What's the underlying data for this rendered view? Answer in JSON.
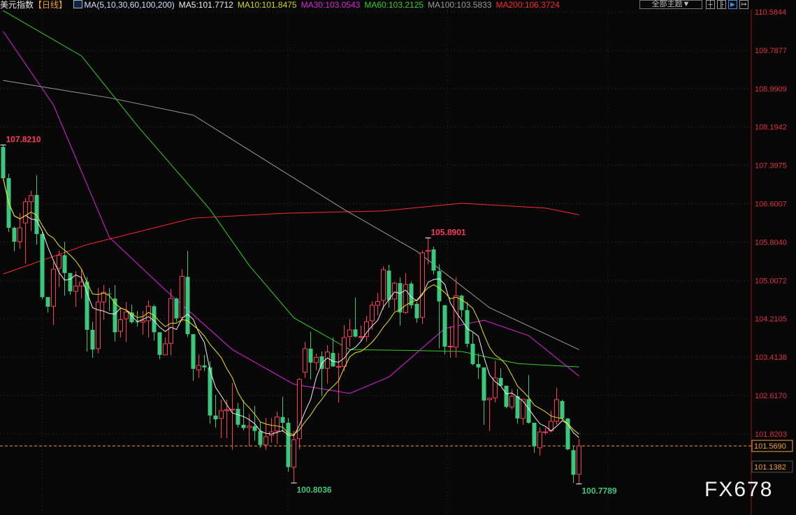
{
  "header": {
    "title": "美元指数",
    "period": "【日线】",
    "ma_params": "MA(5,10,30,60,100,200)",
    "ma5": "MA5:101.7712",
    "ma10": "MA10:101.8475",
    "ma30": "MA30:103.0543",
    "ma60": "MA60:103.2125",
    "ma100": "MA100:103.5833",
    "ma200": "MA200:106.3724"
  },
  "toolbar": {
    "theme_label": "全部主题▼",
    "icons": [
      "crosshair-icon",
      "bar-range-icon",
      "play-icon",
      "export-icon"
    ]
  },
  "watermark": "FX678",
  "colors": {
    "up": "#ff3a55",
    "down": "#3cc87c",
    "ma5": "#f0f0f0",
    "ma10": "#e8e800",
    "ma30": "#e020e0",
    "ma60": "#30d020",
    "ma100": "#9a9a9a",
    "ma200": "#ff2a2a"
  },
  "chart_data": {
    "type": "candlestick",
    "title": "美元指数 日线",
    "y_ticks": [
      "110.5844",
      "109.7877",
      "108.9909",
      "108.1942",
      "107.3975",
      "106.6007",
      "105.8040",
      "105.0072",
      "104.2105",
      "103.4138",
      "102.6170",
      "101.8203"
    ],
    "ylim": [
      100.6,
      110.83
    ],
    "current_price": "101.5690",
    "cursor_price": "101.1382",
    "annotations": [
      {
        "index": 0,
        "text": "107.8210",
        "type": "high"
      },
      {
        "index": 76,
        "text": "105.8901",
        "type": "high"
      },
      {
        "index": 52,
        "text": "100.8036",
        "type": "low"
      },
      {
        "index": 103,
        "text": "100.7789",
        "type": "low"
      }
    ],
    "ohlc": [
      [
        107.78,
        107.82,
        107.1,
        107.13
      ],
      [
        107.13,
        107.22,
        106.01,
        106.1
      ],
      [
        106.1,
        106.13,
        105.61,
        105.81
      ],
      [
        105.81,
        106.4,
        105.66,
        106.1
      ],
      [
        106.2,
        106.72,
        105.36,
        106.64
      ],
      [
        106.64,
        106.87,
        106.03,
        106.77
      ],
      [
        106.78,
        107.19,
        105.75,
        105.97
      ],
      [
        105.97,
        106.01,
        104.62,
        104.66
      ],
      [
        104.66,
        104.66,
        104.34,
        104.46
      ],
      [
        104.47,
        105.39,
        104.08,
        105.24
      ],
      [
        105.26,
        105.63,
        104.87,
        105.53
      ],
      [
        105.53,
        105.81,
        104.69,
        105.16
      ],
      [
        105.16,
        105.16,
        104.71,
        104.78
      ],
      [
        104.78,
        105.2,
        104.46,
        104.89
      ],
      [
        104.89,
        105.24,
        104.63,
        104.97
      ],
      [
        104.98,
        105.08,
        103.53,
        103.98
      ],
      [
        103.98,
        104.15,
        103.4,
        103.57
      ],
      [
        103.59,
        104.85,
        103.49,
        104.56
      ],
      [
        104.56,
        104.91,
        104.19,
        104.76
      ],
      [
        104.73,
        104.85,
        104.37,
        104.72
      ],
      [
        104.63,
        104.91,
        103.74,
        103.93
      ],
      [
        103.95,
        104.41,
        103.82,
        104.19
      ],
      [
        104.21,
        104.56,
        103.73,
        104.35
      ],
      [
        104.34,
        104.5,
        104.11,
        104.14
      ],
      [
        104.15,
        104.37,
        104.05,
        104.14
      ],
      [
        104.14,
        104.37,
        103.88,
        104.17
      ],
      [
        104.17,
        104.59,
        103.82,
        104.47
      ],
      [
        104.47,
        104.5,
        103.76,
        103.93
      ],
      [
        103.93,
        103.93,
        103.37,
        103.46
      ],
      [
        103.46,
        103.82,
        103.45,
        103.69
      ],
      [
        103.7,
        104.83,
        103.45,
        104.63
      ],
      [
        104.63,
        104.65,
        104.15,
        104.22
      ],
      [
        104.24,
        105.24,
        104.15,
        105.09
      ],
      [
        105.08,
        105.62,
        103.83,
        103.89
      ],
      [
        103.89,
        103.89,
        102.92,
        103.17
      ],
      [
        103.15,
        103.47,
        102.98,
        103.24
      ],
      [
        103.24,
        103.46,
        103.12,
        103.2
      ],
      [
        103.2,
        103.33,
        102.03,
        102.2
      ],
      [
        102.2,
        102.63,
        101.95,
        102.12
      ],
      [
        102.14,
        102.53,
        101.73,
        102.3
      ],
      [
        102.3,
        102.53,
        101.73,
        102.32
      ],
      [
        102.32,
        102.88,
        101.49,
        102.33
      ],
      [
        102.34,
        102.46,
        101.95,
        102.01
      ],
      [
        102.01,
        102.52,
        101.89,
        101.94
      ],
      [
        101.95,
        102.24,
        101.56,
        101.98
      ],
      [
        101.98,
        102.4,
        101.68,
        101.88
      ],
      [
        101.88,
        102.08,
        101.53,
        101.59
      ],
      [
        101.59,
        102.15,
        101.49,
        101.76
      ],
      [
        101.79,
        102.15,
        101.64,
        101.86
      ],
      [
        101.88,
        102.28,
        101.61,
        102.17
      ],
      [
        102.17,
        102.59,
        101.86,
        102.05
      ],
      [
        102.05,
        102.15,
        101.03,
        101.13
      ],
      [
        101.13,
        101.88,
        100.8,
        101.7
      ],
      [
        101.72,
        102.98,
        101.5,
        102.95
      ],
      [
        103.1,
        103.73,
        102.98,
        103.59
      ],
      [
        103.59,
        103.94,
        102.95,
        103.3
      ],
      [
        103.3,
        103.49,
        103.14,
        103.41
      ],
      [
        103.43,
        103.53,
        102.6,
        103.17
      ],
      [
        103.18,
        103.66,
        102.86,
        103.52
      ],
      [
        103.5,
        103.82,
        103.21,
        103.22
      ],
      [
        103.22,
        103.5,
        102.47,
        103.22
      ],
      [
        103.22,
        104.08,
        103.12,
        103.82
      ],
      [
        103.84,
        104.2,
        103.63,
        103.98
      ],
      [
        103.99,
        104.65,
        103.82,
        103.84
      ],
      [
        103.84,
        104.07,
        103.75,
        103.84
      ],
      [
        103.84,
        104.27,
        103.73,
        104.15
      ],
      [
        104.17,
        104.57,
        103.98,
        104.49
      ],
      [
        104.49,
        104.75,
        104.28,
        104.57
      ],
      [
        104.59,
        105.3,
        104.4,
        105.23
      ],
      [
        105.21,
        105.33,
        104.44,
        104.6
      ],
      [
        104.62,
        104.98,
        104.37,
        104.95
      ],
      [
        104.95,
        105.07,
        104.07,
        104.34
      ],
      [
        104.34,
        105.16,
        104.31,
        104.92
      ],
      [
        104.94,
        104.98,
        104.42,
        104.49
      ],
      [
        104.52,
        104.56,
        104.13,
        104.22
      ],
      [
        104.24,
        105.63,
        104.1,
        105.58
      ],
      [
        105.61,
        105.89,
        105.34,
        105.63
      ],
      [
        105.65,
        105.71,
        105.13,
        105.21
      ],
      [
        105.2,
        105.34,
        103.6,
        104.57
      ],
      [
        104.49,
        104.5,
        103.47,
        103.63
      ],
      [
        103.63,
        104.05,
        103.4,
        103.64
      ],
      [
        103.62,
        105.07,
        103.41,
        104.69
      ],
      [
        104.69,
        104.71,
        104.24,
        104.39
      ],
      [
        104.39,
        104.56,
        103.62,
        103.69
      ],
      [
        103.69,
        103.92,
        103.24,
        103.27
      ],
      [
        103.27,
        103.49,
        102.96,
        103.2
      ],
      [
        103.2,
        103.2,
        102.01,
        102.51
      ],
      [
        102.53,
        102.56,
        101.88,
        102.56
      ],
      [
        102.57,
        103.34,
        102.47,
        102.98
      ],
      [
        102.98,
        103.18,
        102.82,
        102.82
      ],
      [
        102.82,
        102.82,
        102.35,
        102.38
      ],
      [
        102.38,
        102.75,
        102.33,
        102.6
      ],
      [
        102.6,
        102.75,
        102.03,
        102.14
      ],
      [
        102.14,
        102.54,
        102.01,
        102.54
      ],
      [
        102.54,
        103.04,
        102.03,
        102.05
      ],
      [
        102.05,
        102.05,
        101.43,
        101.56
      ],
      [
        101.53,
        101.95,
        101.37,
        101.86
      ],
      [
        101.86,
        101.95,
        101.8,
        101.86
      ],
      [
        101.88,
        102.3,
        101.85,
        102.08
      ],
      [
        102.08,
        102.78,
        102.01,
        102.53
      ],
      [
        102.5,
        102.53,
        102.08,
        102.14
      ],
      [
        102.14,
        102.14,
        101.48,
        101.5
      ],
      [
        101.48,
        101.57,
        100.8,
        100.97
      ],
      [
        100.98,
        101.71,
        100.78,
        101.57
      ]
    ],
    "ma_series": {
      "ma30": [
        [
          0,
          110.18
        ],
        [
          9,
          108.65
        ],
        [
          19,
          105.9
        ],
        [
          29,
          104.81
        ],
        [
          41,
          103.57
        ],
        [
          52,
          102.85
        ],
        [
          62,
          102.66
        ],
        [
          69,
          103.0
        ],
        [
          79,
          104.01
        ],
        [
          86,
          104.18
        ],
        [
          94,
          103.86
        ],
        [
          103,
          103.02
        ]
      ],
      "ma60": [
        [
          0,
          110.61
        ],
        [
          14,
          109.67
        ],
        [
          24,
          108.22
        ],
        [
          37,
          106.48
        ],
        [
          44,
          105.32
        ],
        [
          52,
          104.23
        ],
        [
          62,
          103.57
        ],
        [
          74,
          103.55
        ],
        [
          82,
          103.53
        ],
        [
          92,
          103.28
        ],
        [
          103,
          103.21
        ]
      ],
      "ma100": [
        [
          0,
          109.16
        ],
        [
          19,
          108.8
        ],
        [
          34,
          108.44
        ],
        [
          49,
          107.35
        ],
        [
          61,
          106.48
        ],
        [
          74,
          105.61
        ],
        [
          87,
          104.44
        ],
        [
          103,
          103.57
        ]
      ],
      "ma200": [
        [
          0,
          105.14
        ],
        [
          15,
          105.75
        ],
        [
          34,
          106.3
        ],
        [
          50,
          106.4
        ],
        [
          68,
          106.45
        ],
        [
          82,
          106.61
        ],
        [
          97,
          106.51
        ],
        [
          103,
          106.37
        ]
      ]
    }
  }
}
